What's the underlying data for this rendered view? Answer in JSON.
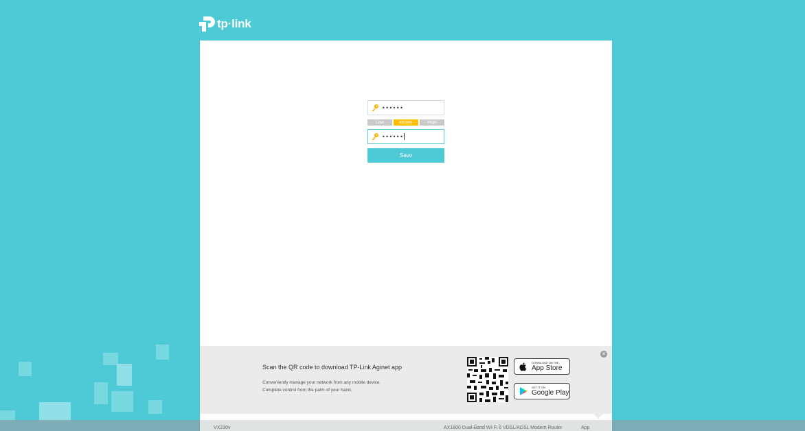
{
  "brand": {
    "logo_text": "tp·link",
    "accent": "#4ecad6"
  },
  "form": {
    "new_password": {
      "value": "••••••",
      "icon": "key-icon"
    },
    "strength": {
      "low": "Low",
      "middle": "Middle",
      "high": "High",
      "current": "Middle",
      "colors": {
        "active": "#ffbe00",
        "inactive": "#c9c9c9"
      }
    },
    "confirm_password": {
      "value": "••••••",
      "icon": "key-icon"
    },
    "save_label": "Save"
  },
  "banner": {
    "title": "Scan the QR code to download TP-Link Aginet app",
    "line1": "Conveniently manage your network from any mobile device.",
    "line2": "Complete control from the palm of your hand.",
    "app_store_small": "DOWNLOAD ON THE",
    "app_store_big": "App Store",
    "google_play_small": "GET IT ON",
    "google_play_big": "Google Play",
    "close_icon": "close-icon"
  },
  "footer": {
    "model": "VX230v",
    "description": "AX1800 Dual-Band Wi-Fi 6 VDSL/ADSL Modem Router",
    "app_link": "App"
  }
}
